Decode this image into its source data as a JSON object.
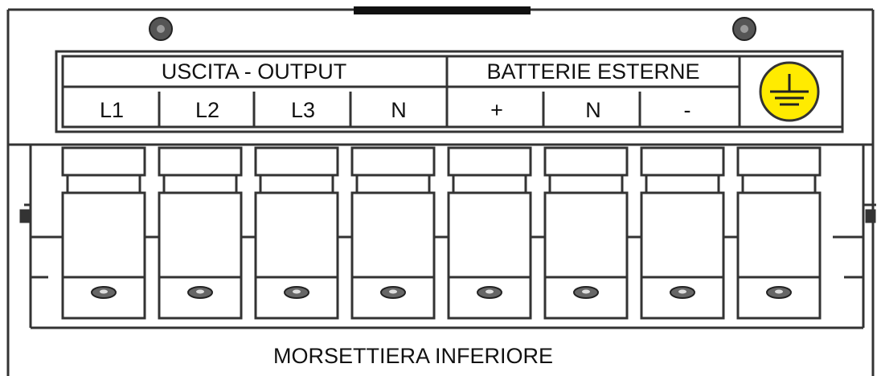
{
  "header": {
    "output_group_label": "USCITA - OUTPUT",
    "battery_group_label": "BATTERIE ESTERNE"
  },
  "terminals": [
    {
      "label": "L1"
    },
    {
      "label": "L2"
    },
    {
      "label": "L3"
    },
    {
      "label": "N"
    },
    {
      "label": "+"
    },
    {
      "label": "N"
    },
    {
      "label": "-"
    }
  ],
  "ground_terminal": {
    "icon": "ground-icon",
    "color": "#FFEB00"
  },
  "footer": {
    "caption": "MORSETTIERA INFERIORE"
  },
  "colors": {
    "stroke": "#333333",
    "ground_fill": "#FFEB00"
  }
}
